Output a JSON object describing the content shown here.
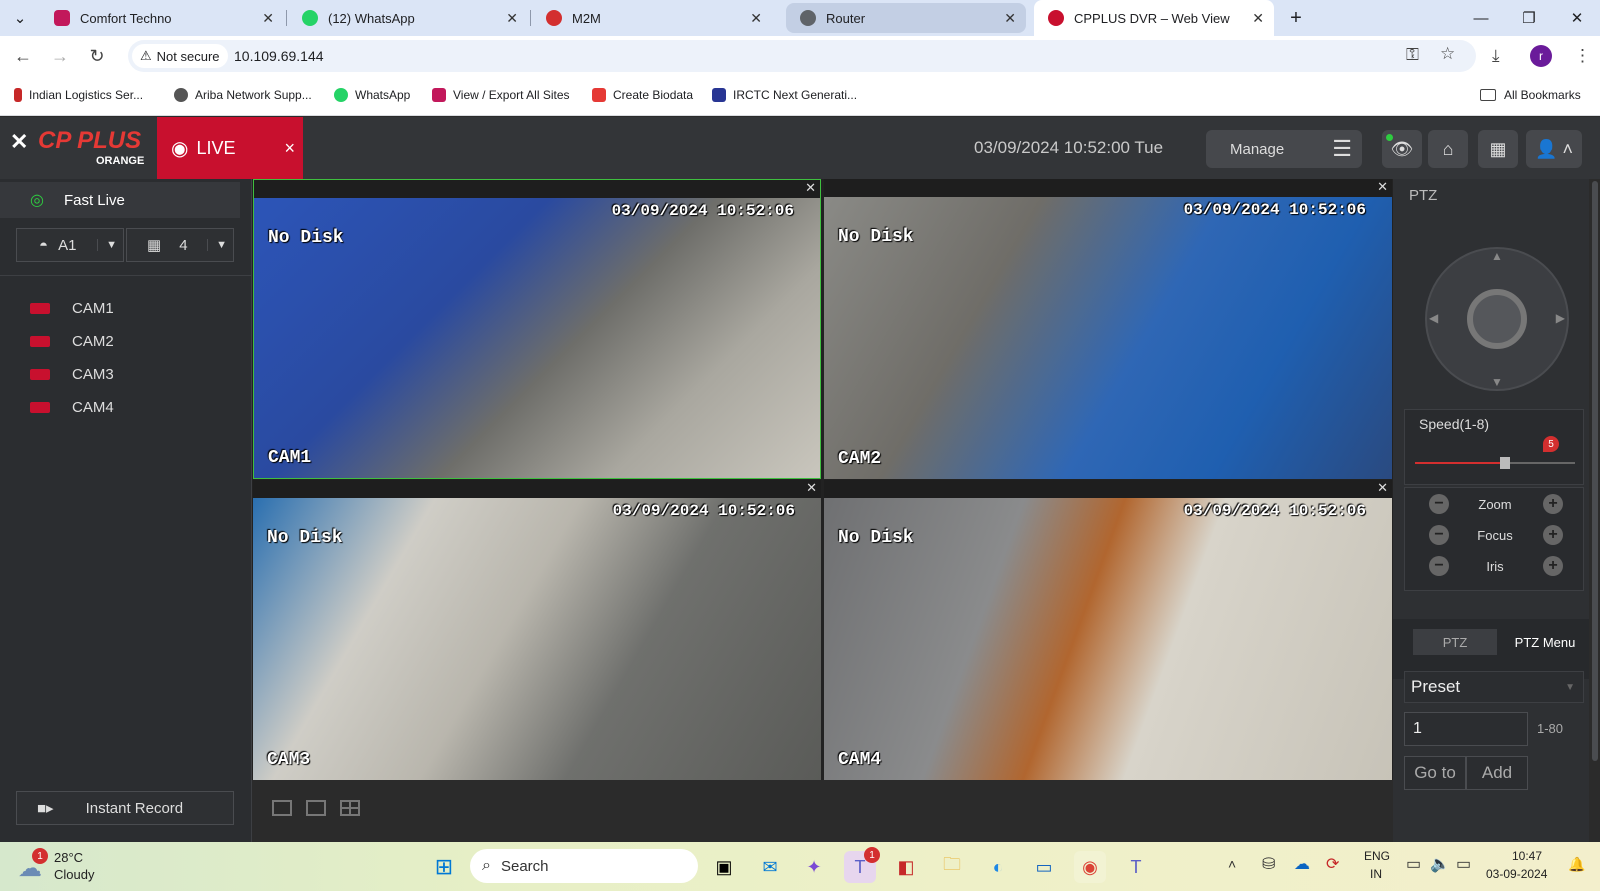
{
  "browser": {
    "tabs": [
      {
        "title": "Comfort Techno",
        "color": "#c2185b"
      },
      {
        "title": "(12) WhatsApp",
        "color": "#25d366"
      },
      {
        "title": "M2M",
        "color": "#d32f2f"
      },
      {
        "title": "Router",
        "color": "#5f6368"
      },
      {
        "title": "CPPLUS DVR – Web View",
        "color": "#c8102e"
      }
    ],
    "security_label": "Not secure",
    "url": "10.109.69.144",
    "profile_initial": "r",
    "bookmarks": [
      {
        "label": "Indian Logistics Ser...",
        "color": "#c62828"
      },
      {
        "label": "Ariba Network Supp...",
        "color": "#555555"
      },
      {
        "label": "WhatsApp",
        "color": "#25d366"
      },
      {
        "label": "View / Export All Sites",
        "color": "#c2185b"
      },
      {
        "label": "Create Biodata",
        "color": "#e53935"
      },
      {
        "label": "IRCTC Next Generati...",
        "color": "#283593"
      }
    ],
    "all_bookmarks": "All Bookmarks"
  },
  "dvr": {
    "logo_main": "CP PLUS",
    "logo_sub": "ORANGE",
    "live_label": "LIVE",
    "live_close": "×",
    "datetime": "03/09/2024 10:52:00 Tue",
    "manage_label": "Manage",
    "sidebar": {
      "fast_live": "Fast Live",
      "channel_select": "A1",
      "layout_select": "4",
      "cameras": [
        "CAM1",
        "CAM2",
        "CAM3",
        "CAM4"
      ],
      "instant_record": "Instant Record"
    },
    "feeds": [
      {
        "timestamp": "03/09/2024 10:52:06",
        "status": "No Disk",
        "name": "CAM1"
      },
      {
        "timestamp": "03/09/2024 10:52:06",
        "status": "No Disk",
        "name": "CAM2"
      },
      {
        "timestamp": "03/09/2024 10:52:06",
        "status": "No Disk",
        "name": "CAM3"
      },
      {
        "timestamp": "03/09/2024 10:52:06",
        "status": "No Disk",
        "name": "CAM4"
      }
    ],
    "ptz": {
      "title": "PTZ",
      "speed_label": "Speed(1-8)",
      "speed_value": "5",
      "speed_fraction": 0.56,
      "zoom_label": "Zoom",
      "focus_label": "Focus",
      "iris_label": "Iris",
      "tab_ptz": "PTZ",
      "tab_menu": "PTZ Menu",
      "preset_label": "Preset",
      "preset_value": "1",
      "preset_range": "1-80",
      "goto_label": "Go to",
      "add_label": "Add"
    }
  },
  "taskbar": {
    "weather_temp": "28°C",
    "weather_desc": "Cloudy",
    "weather_badge": "1",
    "search_placeholder": "Search",
    "lang_top": "ENG",
    "lang_bottom": "IN",
    "time": "10:47",
    "date": "03-09-2024",
    "teams_badge": "1"
  }
}
